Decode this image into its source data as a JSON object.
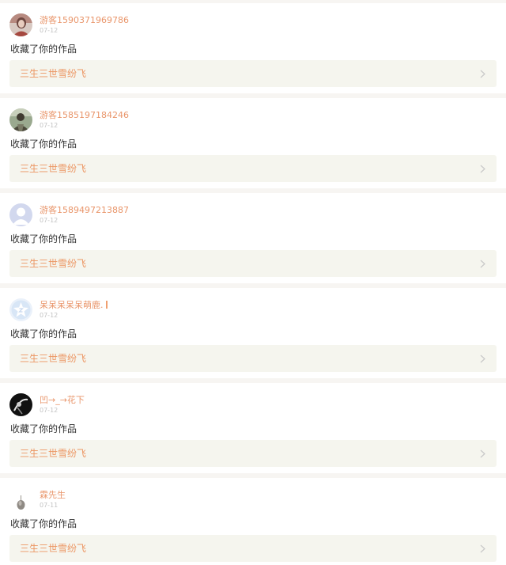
{
  "colors": {
    "username": "#e9966b",
    "work_title": "#ec9663",
    "date": "#c3c3c3",
    "action_text": "#333333",
    "work_bg": "#f5f5ee",
    "page_bg": "#f7f5f2",
    "cursor_mark": "#f0a070"
  },
  "notifications": [
    {
      "username": "游客1590371969786",
      "date": "07-12",
      "action": "收藏了你的作品",
      "work_title": "三生三世雪纷飞",
      "avatar_icon": "photo-avatar-icon"
    },
    {
      "username": "游客1585197184246",
      "date": "07-12",
      "action": "收藏了你的作品",
      "work_title": "三生三世雪纷飞",
      "avatar_icon": "photo-avatar-icon"
    },
    {
      "username": "游客1589497213887",
      "date": "07-12",
      "action": "收藏了你的作品",
      "work_title": "三生三世雪纷飞",
      "avatar_icon": "default-user-avatar-icon"
    },
    {
      "username": "呆呆呆呆呆萌鹿.",
      "date": "07-12",
      "action": "收藏了你的作品",
      "work_title": "三生三世雪纷飞",
      "avatar_icon": "star-badge-avatar-icon"
    },
    {
      "username": "凹→_→花下",
      "date": "07-12",
      "action": "收藏了你的作品",
      "work_title": "三生三世雪纷飞",
      "avatar_icon": "photo-avatar-icon"
    },
    {
      "username": "霖先生",
      "date": "07-11",
      "action": "收藏了你的作品",
      "work_title": "三生三世雪纷飞",
      "avatar_icon": "photo-avatar-icon"
    }
  ]
}
